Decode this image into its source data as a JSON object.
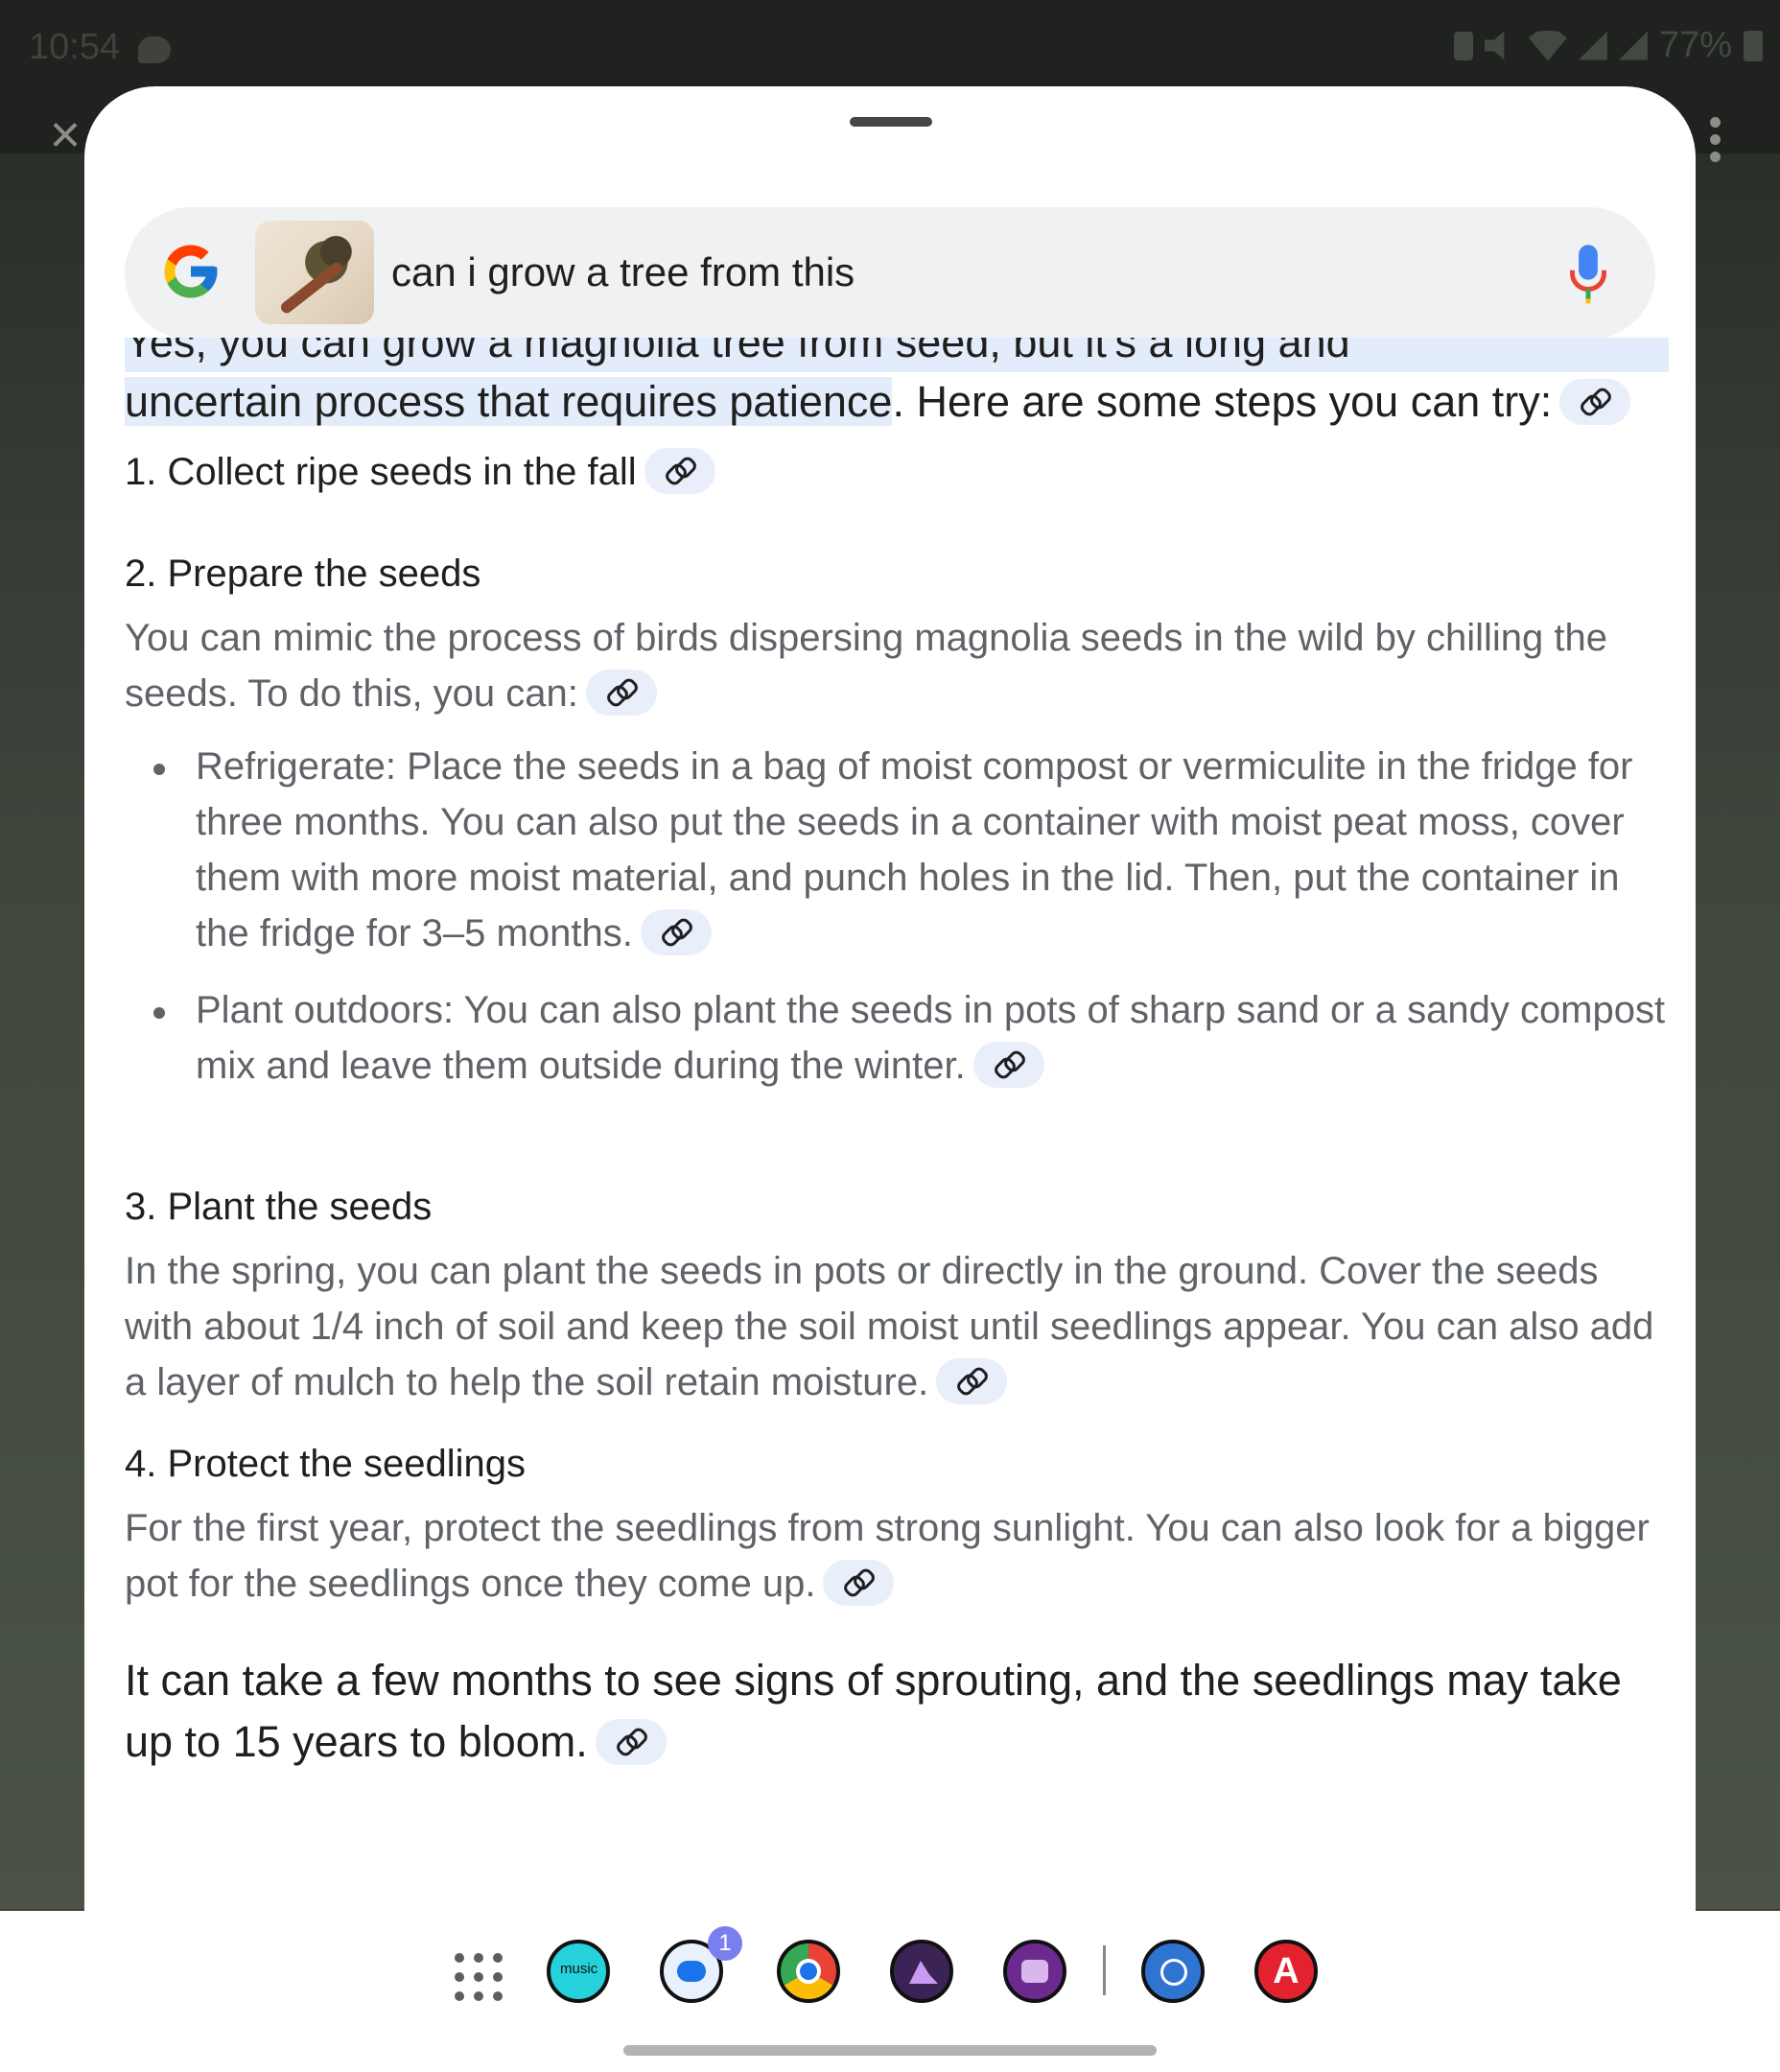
{
  "status_bar": {
    "time": "10:54",
    "battery": "77%"
  },
  "search": {
    "query": "can i grow a tree from this"
  },
  "answer": {
    "intro_cut": "Yes, you can grow a magnolia tree from seed, but it's a long and",
    "intro_hl": "uncertain process that requires patience",
    "intro_rest": ". Here are some steps you can try:",
    "steps": [
      {
        "heading": "1. Collect ripe seeds in the fall"
      },
      {
        "heading": "2. Prepare the seeds",
        "body": "You can mimic the process of birds dispersing magnolia seeds in the wild by chilling the seeds. To do this, you can:",
        "bullets": [
          "Refrigerate: Place the seeds in a bag of moist compost or vermiculite in the fridge for three months. You can also put the seeds in a container with moist peat moss, cover them with more moist material, and punch holes in the lid. Then, put the container in the fridge for 3–5 months.",
          "Plant outdoors: You can also plant the seeds in pots of sharp sand or a sandy compost mix and leave them outside during the winter."
        ]
      },
      {
        "heading": "3. Plant the seeds",
        "body": "In the spring, you can plant the seeds in pots or directly in the ground. Cover the seeds with about 1/4 inch of soil and keep the soil moist until seedlings appear. You can also add a layer of mulch to help the soil retain moisture."
      },
      {
        "heading": "4. Protect the seedlings",
        "body": "For the first year, protect the seedlings from strong sunlight. You can also look for a bigger pot for the seedlings once they come up."
      }
    ],
    "outro": "It can take a few months to see signs of sprouting, and the seedlings may take up to 15 years to bloom."
  },
  "taskbar": {
    "apps": [
      "apps-grid",
      "amazon-music",
      "messages",
      "chrome",
      "gallery",
      "camera",
      "app-blue",
      "app-red"
    ],
    "music_label": "music",
    "messages_badge": "1",
    "red_app_letter": "A"
  }
}
